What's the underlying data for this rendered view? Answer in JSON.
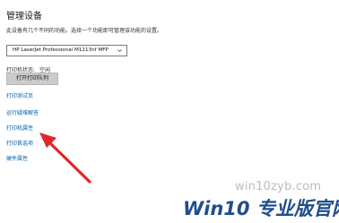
{
  "page": {
    "title": "管理设备",
    "description": "此设备有几个不同的功能。选择一个功能即可管理该功能的设置。"
  },
  "printer_select": {
    "selected": "HP LaserJet Professional M1213nf MFP",
    "chevron_icon": "chevron-down-icon"
  },
  "status": {
    "label": "打印机状态:",
    "value": "空闲"
  },
  "queue_button": {
    "label": "打开打印队列"
  },
  "links": {
    "test_page": "打印测试页",
    "troubleshooter": "运行疑难解答",
    "printer_properties": "打印机属性",
    "printing_preferences": "打印首选项",
    "hardware_properties": "硬件属性"
  },
  "annotation": {
    "arrow_color": "#e0262a"
  },
  "watermark": {
    "site": "win10zyb.com",
    "brand": "Win10 专业版官网"
  },
  "colors": {
    "link": "#0063b1",
    "button": "#cccccc",
    "brand_blue": "#1f4e8c"
  }
}
